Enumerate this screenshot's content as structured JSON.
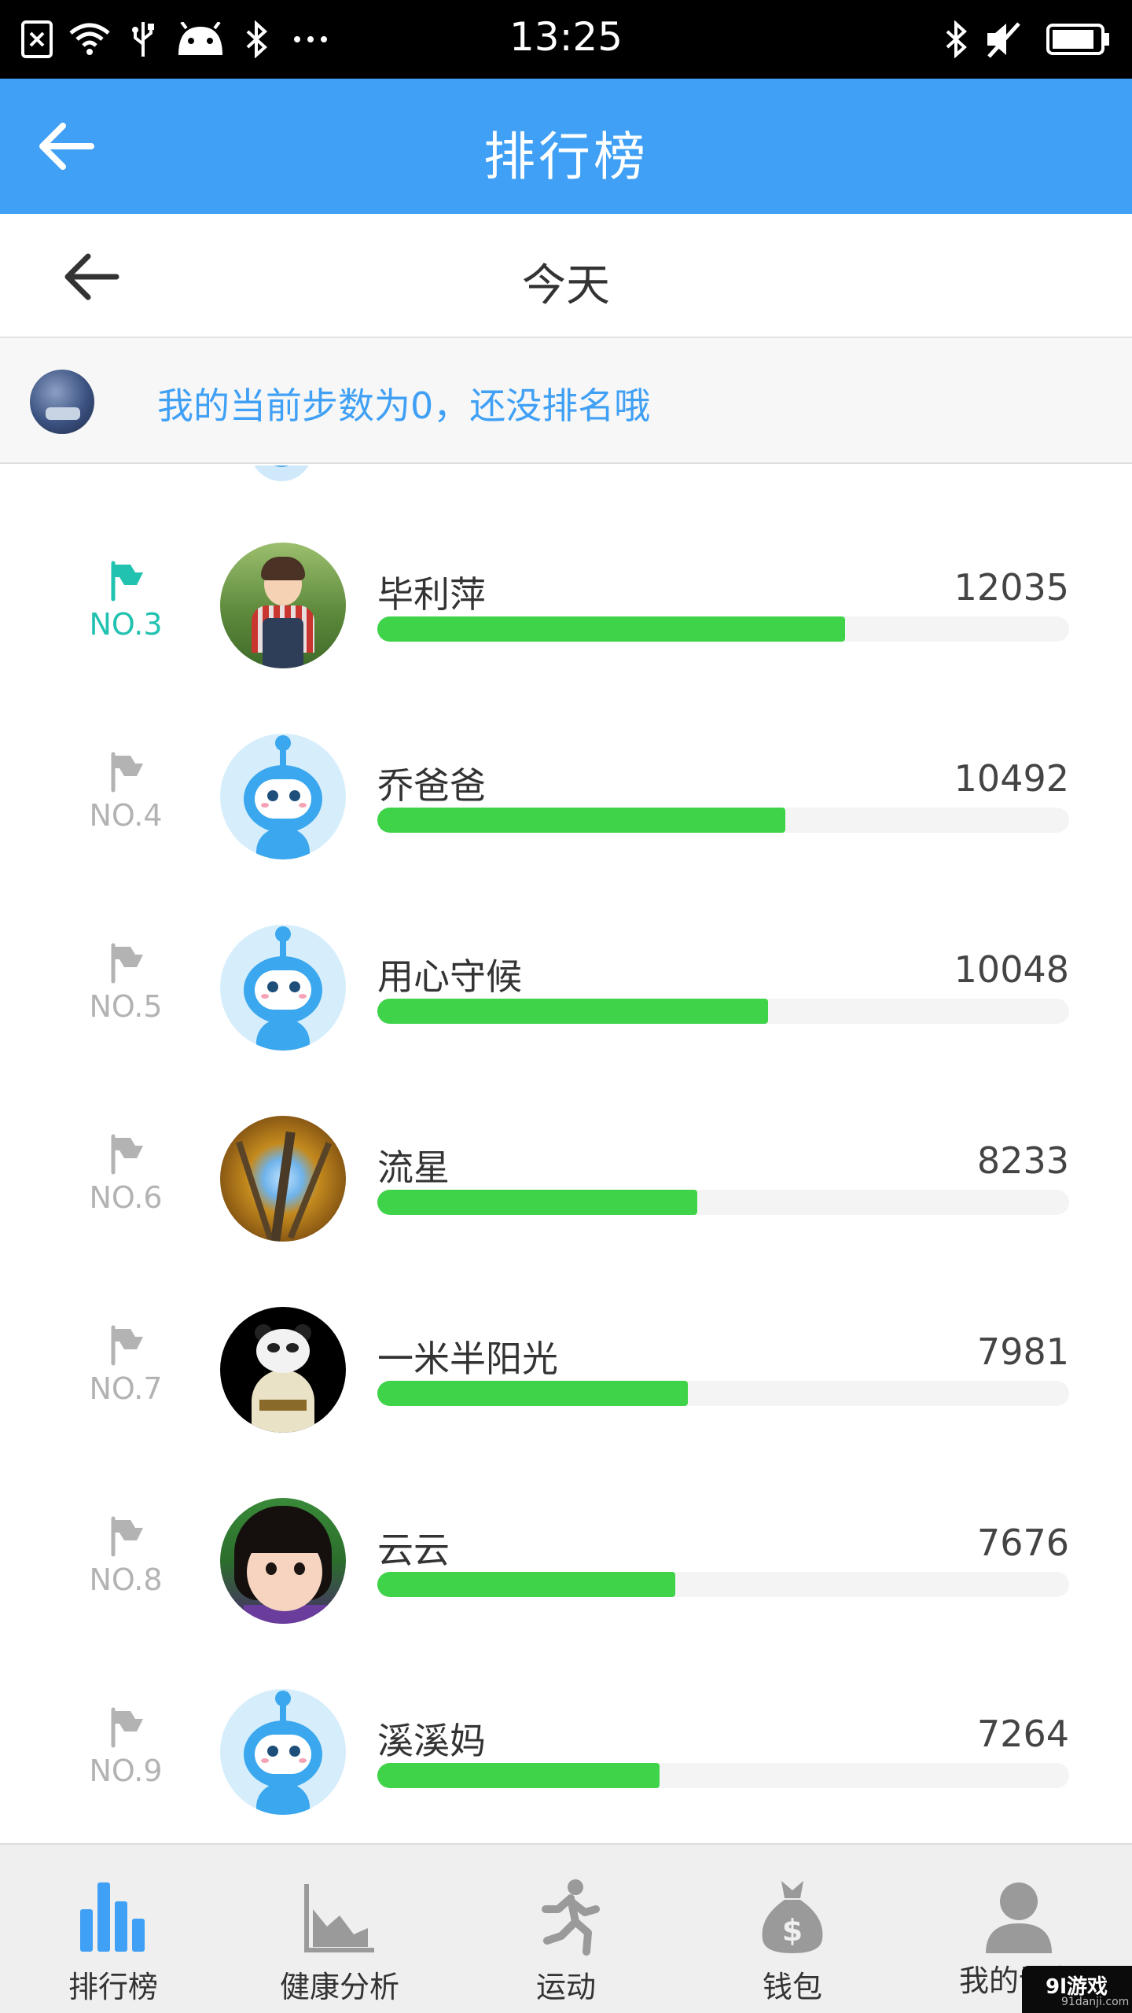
{
  "status_bar": {
    "time": "13:25"
  },
  "header": {
    "title": "排行榜"
  },
  "date_bar": {
    "label": "今天"
  },
  "my_status": {
    "message": "我的当前步数为0，还没排名哦"
  },
  "leaderboard": {
    "max_steps": 17800,
    "rows": [
      {
        "rank": "NO.3",
        "name": "毕利萍",
        "steps": "12035",
        "value": 12035,
        "avatar": "child"
      },
      {
        "rank": "NO.4",
        "name": "乔爸爸",
        "steps": "10492",
        "value": 10492,
        "avatar": "robot"
      },
      {
        "rank": "NO.5",
        "name": "用心守候",
        "steps": "10048",
        "value": 10048,
        "avatar": "robot"
      },
      {
        "rank": "NO.6",
        "name": "流星",
        "steps": "8233",
        "value": 8233,
        "avatar": "trees"
      },
      {
        "rank": "NO.7",
        "name": "一米半阳光",
        "steps": "7981",
        "value": 7981,
        "avatar": "panda"
      },
      {
        "rank": "NO.8",
        "name": "云云",
        "steps": "7676",
        "value": 7676,
        "avatar": "girl"
      },
      {
        "rank": "NO.9",
        "name": "溪溪妈",
        "steps": "7264",
        "value": 7264,
        "avatar": "robot"
      }
    ]
  },
  "bottom_nav": {
    "items": [
      {
        "label": "排行榜",
        "icon": "bar-chart-icon",
        "active": true
      },
      {
        "label": "健康分析",
        "icon": "area-chart-icon",
        "active": false
      },
      {
        "label": "运动",
        "icon": "runner-icon",
        "active": false
      },
      {
        "label": "钱包",
        "icon": "money-bag-icon",
        "active": false
      },
      {
        "label": "我的设备",
        "icon": "person-icon",
        "active": false
      }
    ]
  },
  "watermark": {
    "main": "9l游戏",
    "sub": "91danji.com"
  },
  "colors": {
    "header_blue": "#3fa0f5",
    "bar_green": "#3fd34a",
    "rank_top_teal": "#22c2b0",
    "rank_gray": "#b3b3b3"
  }
}
